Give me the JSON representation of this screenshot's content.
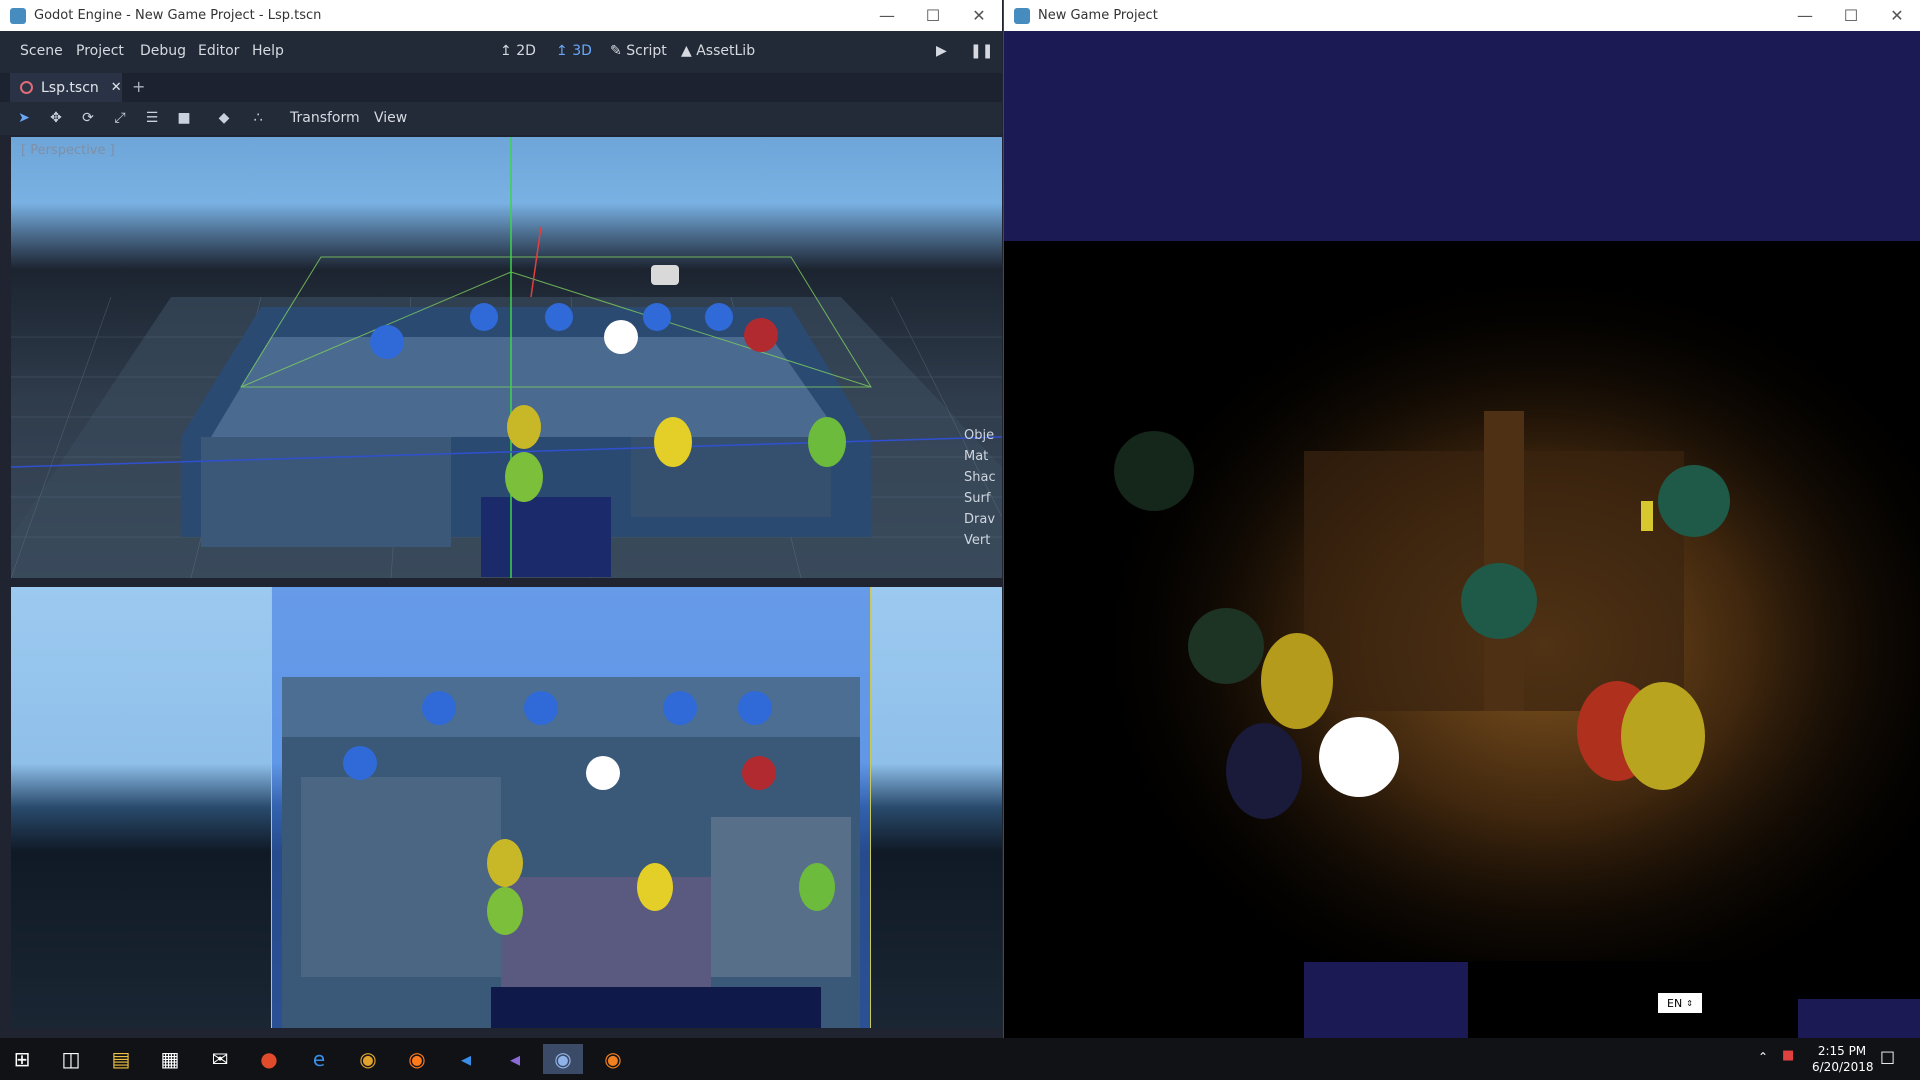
{
  "godot": {
    "window_title": "Godot Engine - New Game Project - Lsp.tscn",
    "menus": [
      "Scene",
      "Project",
      "Debug",
      "Editor",
      "Help"
    ],
    "workspaces": {
      "two_d": "2D",
      "three_d": "3D",
      "script": "Script",
      "assetlib": "AssetLib"
    },
    "tab_label": "Lsp.tscn",
    "toolbar_menus": {
      "transform": "Transform",
      "view": "View"
    },
    "viewport_label": "[ Perspective ]",
    "stats_labels": [
      "Obje",
      "Mat",
      "Shac",
      "Surf",
      "Drav",
      "Vert"
    ]
  },
  "game": {
    "window_title": "New Game Project",
    "lang_select": "EN"
  },
  "taskbar": {
    "time": "2:15 PM",
    "date": "6/20/2018"
  },
  "colors": {
    "accent": "#6aa8f7",
    "game_bg": "#1b1a55"
  }
}
